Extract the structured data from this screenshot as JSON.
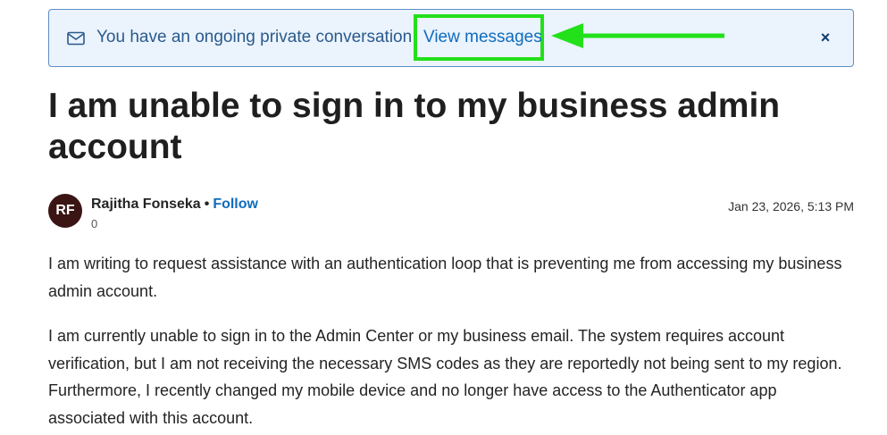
{
  "banner": {
    "message": "You have an ongoing private conversation",
    "link_label": "View messages",
    "icons": {
      "mail": "mail-icon",
      "close": "close-icon",
      "annotation": "arrow-annotation"
    },
    "highlight_color": "#22e01a",
    "close_glyph": "×"
  },
  "post": {
    "title": "I am unable to sign in to my business admin account",
    "author": {
      "initials": "RF",
      "name": "Rajitha Fonseka",
      "separator": "•",
      "follow_label": "Follow",
      "points": "0"
    },
    "date": "Jan 23, 2026, 5:13 PM",
    "paragraphs": [
      "I am writing to request assistance with an authentication loop that is preventing me from accessing my business admin account.",
      "I am currently unable to sign in to the Admin Center or my business email. The system requires account verification, but I am not receiving the necessary SMS codes as they are reportedly not being sent to my region. Furthermore, I recently changed my mobile device and no longer have access to the Authenticator app associated with this account."
    ]
  }
}
